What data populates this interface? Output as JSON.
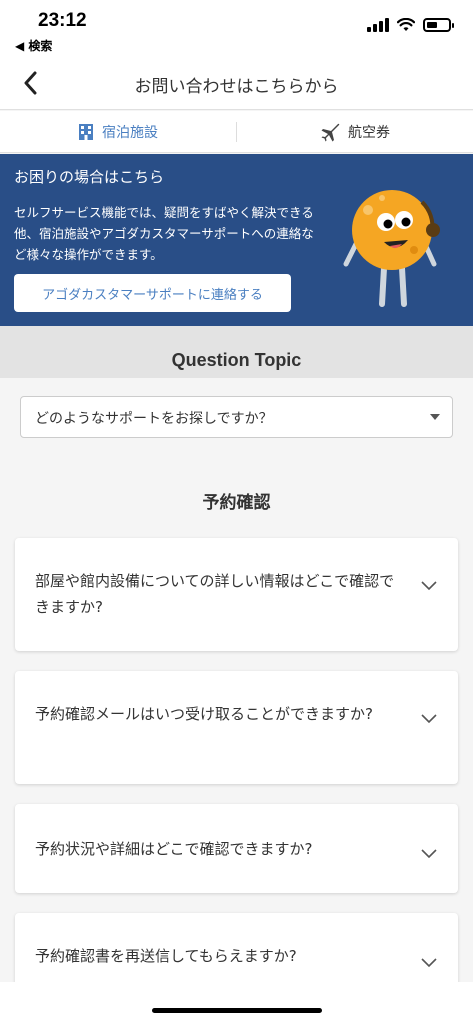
{
  "status_bar": {
    "time": "23:12",
    "back_app": "◀ 検索"
  },
  "header": {
    "title": "お問い合わせはこちらから"
  },
  "tabs": [
    {
      "label": "宿泊施設",
      "icon": "hotel-icon",
      "active": true
    },
    {
      "label": "航空券",
      "icon": "airplane-icon",
      "active": false
    }
  ],
  "banner": {
    "title": "お困りの場合はこちら",
    "description": "セルフサービス機能では、疑問をすばやく解決できる他、宿泊施設やアゴダカスタマーサポートへの連絡など様々な操作ができます。",
    "button_label": "アゴダカスタマーサポートに連絡する"
  },
  "topic": {
    "title": "Question Topic",
    "select_value": "どのようなサポートをお探しですか？"
  },
  "section": {
    "heading": "予約確認"
  },
  "faqs": [
    {
      "question": "部屋や館内設備についての詳しい情報はどこで確認できますか?"
    },
    {
      "question": "予約確認メールはいつ受け取ることができますか?"
    },
    {
      "question": "予約状況や詳細はどこで確認できますか?"
    },
    {
      "question": "予約確認書を再送信してもらえますか?"
    }
  ],
  "colors": {
    "banner_bg": "#294e87",
    "accent": "#4a7fc1",
    "mascot": "#f5a623"
  }
}
